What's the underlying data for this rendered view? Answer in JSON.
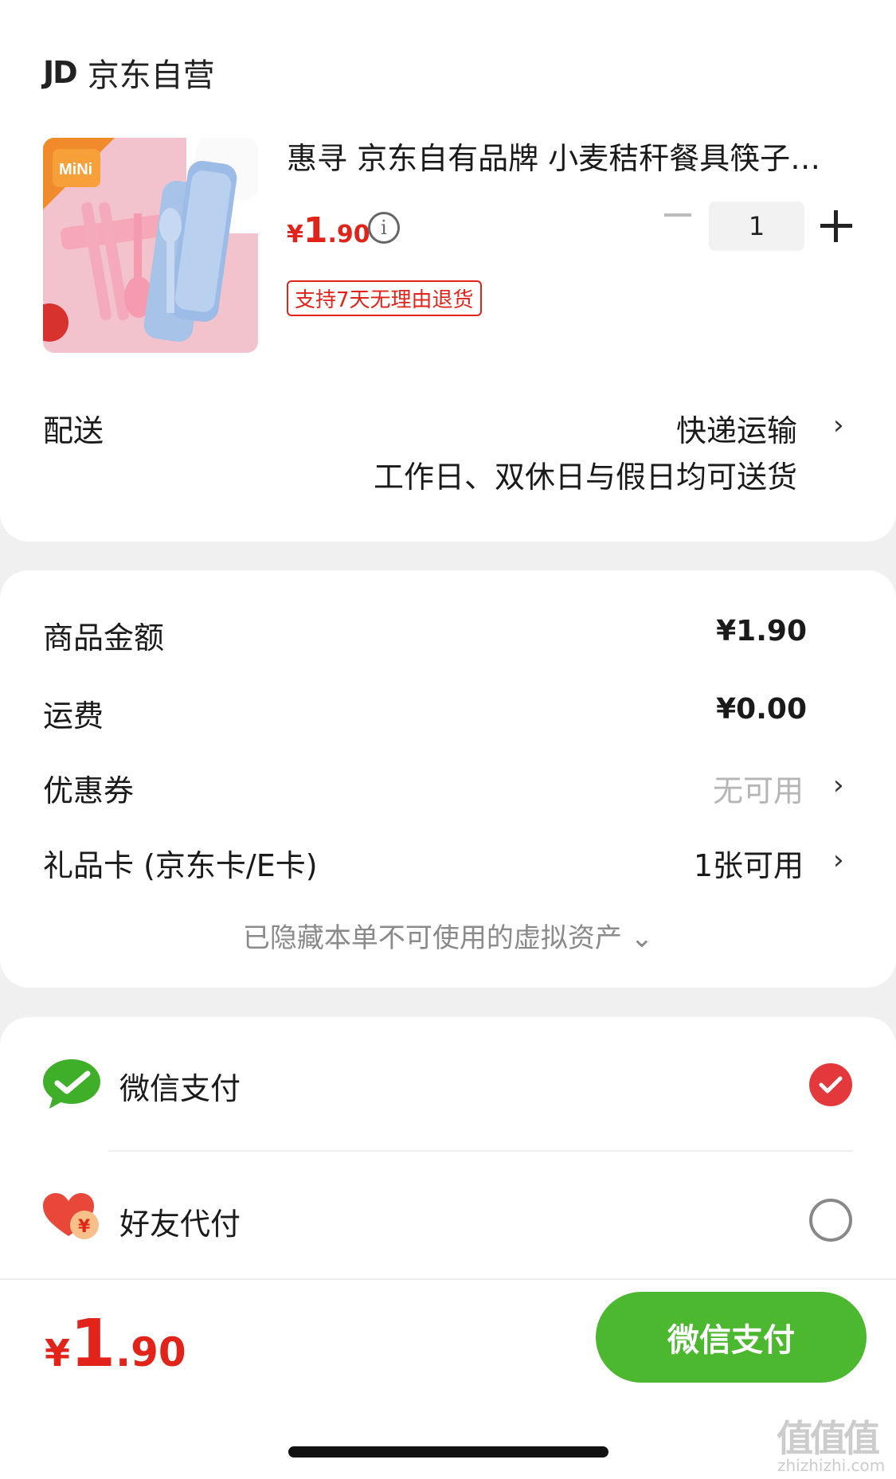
{
  "store": {
    "logo_text": "JD",
    "name": "京东自营"
  },
  "product": {
    "title": "惠寻 京东自有品牌 小麦秸秆餐具筷子…",
    "price_currency": "¥",
    "price_int": "1",
    "price_dec": ".90",
    "info_icon": "i",
    "quantity": "1",
    "return_badge": "支持7天无理由退货",
    "image_brand_text": "MiNi"
  },
  "delivery": {
    "label": "配送",
    "method": "快递运输",
    "schedule": "工作日、双休日与假日均可送货"
  },
  "summary": {
    "goods_label": "商品金额",
    "goods_value": "¥1.90",
    "shipping_label": "运费",
    "shipping_value": "¥0.00",
    "coupon_label": "优惠券",
    "coupon_value": "无可用",
    "giftcard_label": "礼品卡 (京东卡/E卡)",
    "giftcard_value": "1张可用",
    "hidden_note": "已隐藏本单不可使用的虚拟资产 ⌄"
  },
  "payment": {
    "wechat_label": "微信支付",
    "friend_label": "好友代付",
    "selected": "wechat",
    "friend_icon_text": "¥"
  },
  "footer": {
    "total_currency": "¥",
    "total_int": "1",
    "total_dec": ".90",
    "pay_button": "微信支付"
  },
  "watermark": {
    "text": "值值值",
    "site": "zhizhizhi.com"
  },
  "colors": {
    "accent_red": "#e2231a",
    "wechat_green": "#4cb82f",
    "radio_red": "#e4393c"
  },
  "chevron": "›"
}
